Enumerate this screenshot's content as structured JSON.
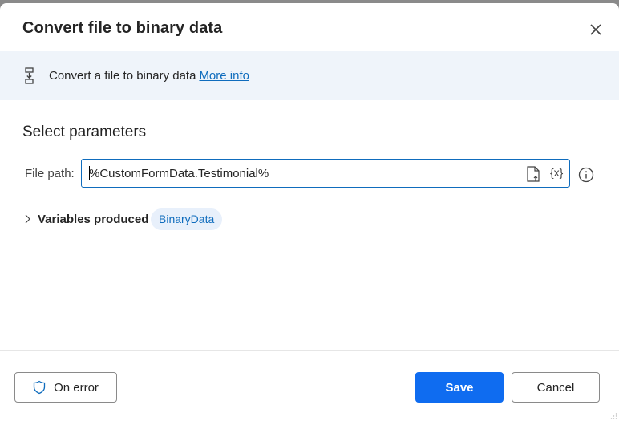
{
  "dialog": {
    "title": "Convert file to binary data",
    "close_icon": "close-icon"
  },
  "info": {
    "icon": "convert-file-icon",
    "description": "Convert a file to binary data",
    "link": "More info"
  },
  "parameters": {
    "section_title": "Select parameters",
    "file_path": {
      "label": "File path:",
      "value": "%CustomFormData.Testimonial%",
      "file_picker_icon": "file-upload-icon",
      "variable_icon_label": "{x}",
      "help_icon": "info-icon"
    }
  },
  "variables": {
    "label": "Variables produced",
    "items": [
      "BinaryData"
    ]
  },
  "footer": {
    "on_error": "On error",
    "save": "Save",
    "cancel": "Cancel"
  },
  "colors": {
    "accent": "#0f6cbd",
    "primary_button": "#0f6cf0",
    "info_bar_bg": "#eff4fa",
    "pill_bg": "#e8f0fb"
  }
}
